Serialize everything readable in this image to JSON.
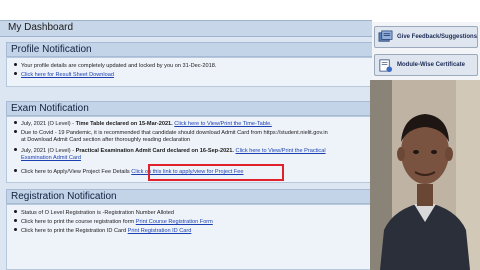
{
  "dashboard": {
    "title": "My Dashboard"
  },
  "profile": {
    "heading": "Profile Notification",
    "items": [
      "Your profile details are completely updated and locked by you on 31-Dec-2018.",
      "Click here for Result Sheet Download"
    ]
  },
  "exam": {
    "heading": "Exam Notification",
    "item1": {
      "prefix": "July, 2021 (O Level) - ",
      "bold": "Time Table declared on 15-Mar-2021.",
      "link": "Click here to View/Print the Time-Table."
    },
    "item2": {
      "line1": "Due to Covid - 19 Pandemic, it is recommended that candidate should download Admit Card from https://student.nielit.gov.in",
      "line2": "at Download Admit Card section after thoroughly reading declaration"
    },
    "item3": {
      "prefix": "July, 2021 (O Level) - ",
      "bold": "Practical Examination Admit Card declared on 16-Sep-2021.",
      "link1": "Click here to View/Print the Practical",
      "link2": "Examination Admit Card"
    },
    "item4": {
      "text": "Click here to Apply/View Project Fee Details",
      "link": "Click on this link to apply/view for Project Fee"
    }
  },
  "registration": {
    "heading": "Registration Notification",
    "item1": "Status of O Level Registration is  -Registration Number Alloted",
    "item2": {
      "text": "Click here to print the course registration form",
      "link": "Print Course Registration Form"
    },
    "item3": {
      "text": "Click here to print the Registration ID Card",
      "link": "Print Registration ID Card"
    }
  },
  "sidebar": {
    "feedback_button": "Give Feedback/Suggestions",
    "certificate_button": "Module-Wise Certificate"
  },
  "colors": {
    "highlight": "#e0202a",
    "link": "#1b3fb0",
    "section_head": "#c4d4e8"
  }
}
